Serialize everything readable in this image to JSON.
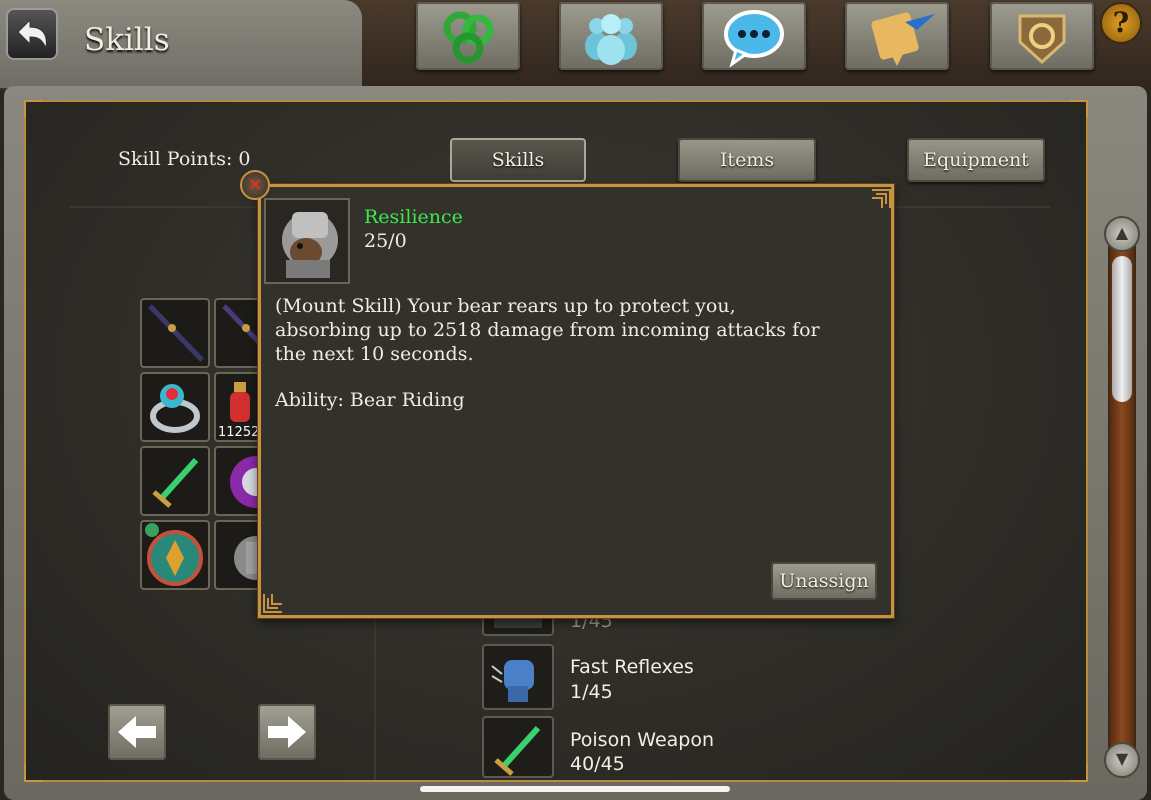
{
  "header": {
    "title": "Skills",
    "nav": [
      {
        "name": "skills-tree-icon"
      },
      {
        "name": "guild-icon"
      },
      {
        "name": "chat-icon"
      },
      {
        "name": "quests-icon"
      },
      {
        "name": "crest-icon"
      }
    ],
    "help": "?"
  },
  "panel": {
    "skill_points": "Skill Points: 0",
    "tabs": [
      {
        "label": "Skills",
        "active": true
      },
      {
        "label": "Items",
        "active": false
      },
      {
        "label": "Equipment",
        "active": false
      }
    ]
  },
  "inventory": {
    "visible_count": "11252"
  },
  "skills_list": [
    {
      "name": "",
      "level": "1/45"
    },
    {
      "name": "Fast Reflexes",
      "level": "1/45"
    },
    {
      "name": "Poison Weapon",
      "level": "40/45"
    }
  ],
  "tooltip": {
    "name": "Resilience",
    "level": "25/0",
    "description": "(Mount Skill) Your bear rears up to protect you, absorbing up to 2518 damage from incoming attacks for the next 10 seconds.",
    "ability": "Ability: Bear Riding",
    "unassign_label": "Unassign",
    "close": "×"
  },
  "colors": {
    "accent_gold": "#c8923e",
    "skill_name_green": "#3ee84a"
  }
}
